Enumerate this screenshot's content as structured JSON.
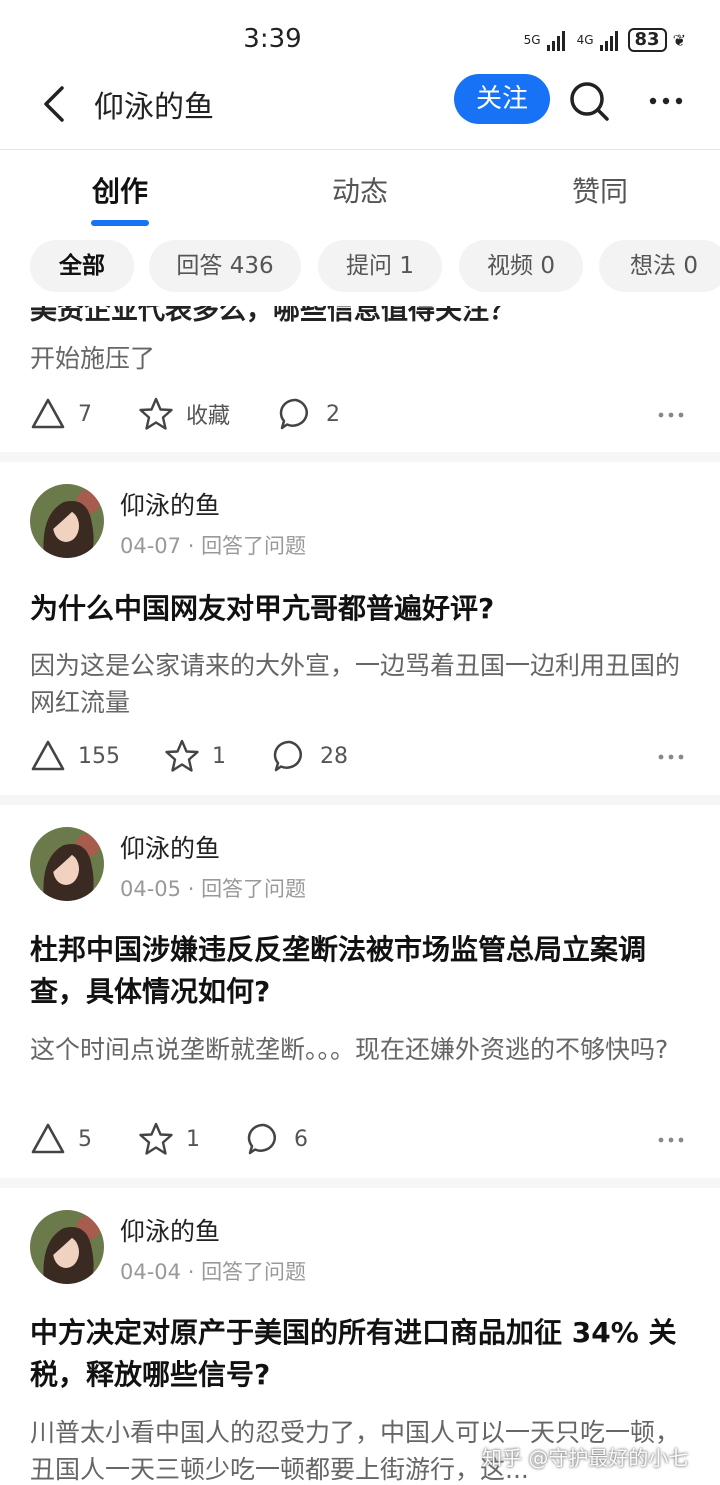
{
  "status": {
    "time": "3:39",
    "net1": "5G",
    "net2": "4G",
    "battery": "83"
  },
  "nav": {
    "title": "仰泳的鱼",
    "follow_label": "关注"
  },
  "tabs": [
    {
      "label": "创作"
    },
    {
      "label": "动态"
    },
    {
      "label": "赞同"
    }
  ],
  "filters": [
    {
      "label": "全部"
    },
    {
      "label": "回答 436"
    },
    {
      "label": "提问 1"
    },
    {
      "label": "视频 0"
    },
    {
      "label": "想法 0"
    }
  ],
  "cards": [
    {
      "title_cut": "美资企业代表多么，哪些信息值得关注？",
      "excerpt": "开始施压了",
      "likes": "7",
      "fav": "收藏",
      "comments": "2"
    },
    {
      "author": "仰泳的鱼",
      "date": "04-07",
      "action": "回答了问题",
      "title": "为什么中国网友对甲亢哥都普遍好评?",
      "excerpt": "因为这是公家请来的大外宣，一边骂着丑国一边利用丑国的网红流量",
      "likes": "155",
      "fav": "1",
      "comments": "28"
    },
    {
      "author": "仰泳的鱼",
      "date": "04-05",
      "action": "回答了问题",
      "title": "杜邦中国涉嫌违反反垄断法被市场监管总局立案调查，具体情况如何?",
      "excerpt": "这个时间点说垄断就垄断。。。现在还嫌外资逃的不够快吗?",
      "likes": "5",
      "fav": "1",
      "comments": "6"
    },
    {
      "author": "仰泳的鱼",
      "date": "04-04",
      "action": "回答了问题",
      "title": "中方决定对原产于美国的所有进口商品加征 34% 关税，释放哪些信号?",
      "excerpt": "川普太小看中国人的忍受力了，中国人可以一天只吃一顿，丑国人一天三顿少吃一顿都要上街游行，这..."
    }
  ],
  "watermark": "知乎 @守护最好的小七",
  "colors": {
    "accent": "#1772f6",
    "background": "#f6f6f6"
  }
}
